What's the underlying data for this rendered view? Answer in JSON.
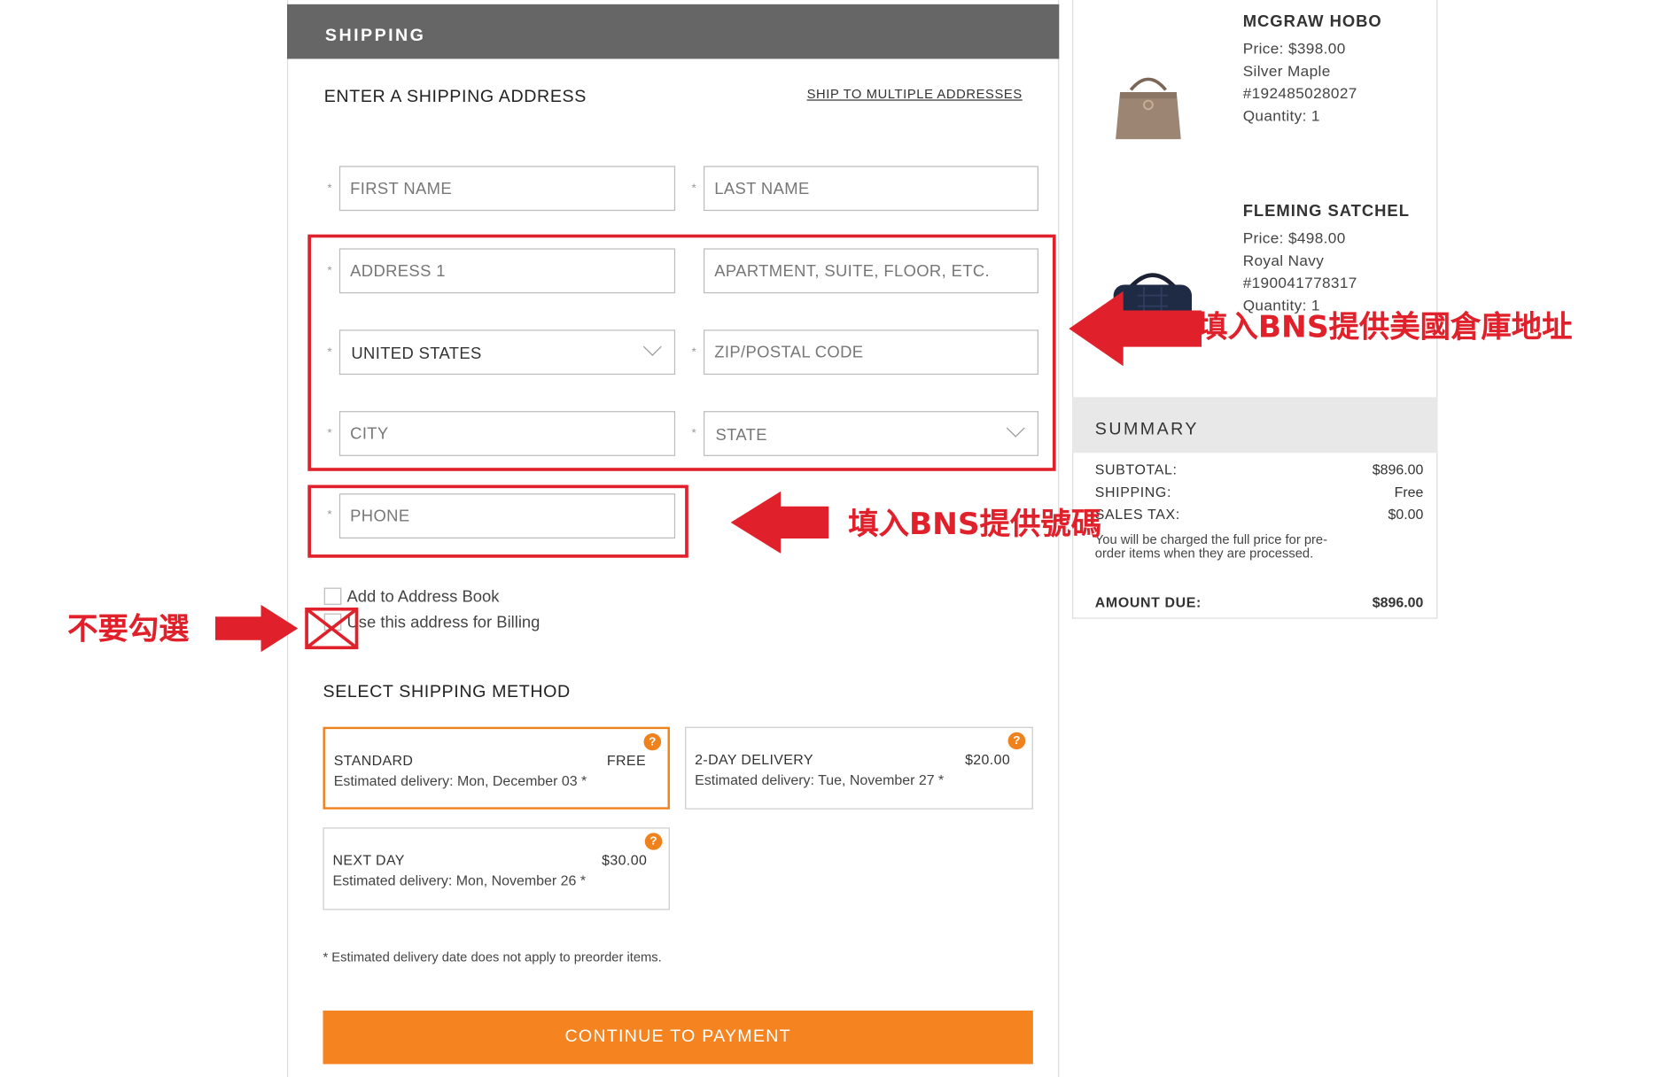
{
  "shipping": {
    "header": "SHIPPING",
    "section_title": "ENTER A SHIPPING ADDRESS",
    "multi_link": "SHIP TO MULTIPLE ADDRESSES",
    "required_mark": "*",
    "fields": {
      "first_name": "FIRST NAME",
      "last_name": "LAST NAME",
      "address1": "ADDRESS 1",
      "address2": "APARTMENT, SUITE, FLOOR, ETC.",
      "country": "UNITED STATES",
      "zip": "ZIP/POSTAL CODE",
      "city": "CITY",
      "state": "STATE",
      "phone": "PHONE"
    },
    "add_to_book": "Add to Address Book",
    "use_for_billing": "Use this address for Billing",
    "method_title": "SELECT SHIPPING METHOD",
    "methods": [
      {
        "name": "STANDARD",
        "price": "FREE",
        "estimate": "Estimated delivery: Mon, December 03 *",
        "help": "?"
      },
      {
        "name": "2-DAY DELIVERY",
        "price": "$20.00",
        "estimate": "Estimated delivery: Tue, November 27 *",
        "help": "?"
      },
      {
        "name": "NEXT DAY",
        "price": "$30.00",
        "estimate": "Estimated delivery: Mon, November 26 *",
        "help": "?"
      }
    ],
    "footnote": "* Estimated delivery date does not apply to preorder items.",
    "continue": "CONTINUE TO PAYMENT"
  },
  "cart": {
    "items": [
      {
        "name": "MCGRAW HOBO",
        "price": "Price:  $398.00",
        "color": "Silver Maple",
        "sku": "#192485028027",
        "qty": "Quantity: 1"
      },
      {
        "name": "FLEMING SATCHEL",
        "price": "Price:  $498.00",
        "color": "Royal Navy",
        "sku": "#190041778317",
        "qty": "Quantity: 1"
      }
    ]
  },
  "summary": {
    "title": "SUMMARY",
    "subtotal_label": "SUBTOTAL:",
    "subtotal": "$896.00",
    "shipping_label": "SHIPPING:",
    "shipping": "Free",
    "tax_label": "SALES TAX:",
    "tax": "$0.00",
    "preorder_note": "You will be charged the full price for pre-order items when they are processed.",
    "due_label": "AMOUNT DUE:",
    "due": "$896.00"
  },
  "annotations": {
    "address": "填入BNS提供美國倉庫地址",
    "phone": "填入BNS提供號碼",
    "nocheck": "不要勾選"
  },
  "colors": {
    "accent": "#f5831f",
    "header": "#666666",
    "annotation": "#e0202a"
  }
}
